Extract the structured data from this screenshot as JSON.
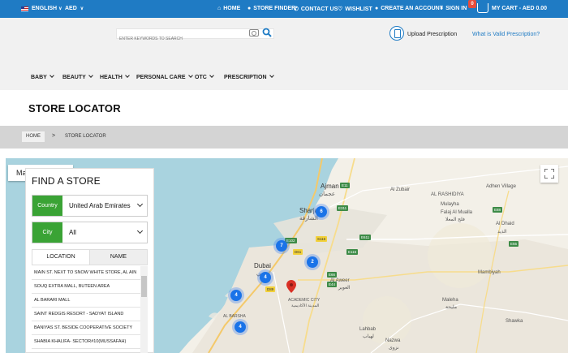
{
  "topbar": {
    "language": "ENGLISH",
    "currency": "AED",
    "links": {
      "home": "HOME",
      "store_finder": "STORE FINDER",
      "contact": "CONTACT US",
      "wishlist": "WISHLIST",
      "create_account": "CREATE AN ACCOUNT",
      "sign_in": "SIGN IN"
    },
    "cart_count": "0",
    "cart_label": "MY CART - AED 0.00",
    "bg_color": "#1f7bc4"
  },
  "header": {
    "search_placeholder": "ENTER KEYWORDS TO SEARCH",
    "upload_prescription": "Upload Prescription",
    "valid_prescription": "What is Valid Prescription?"
  },
  "nav": {
    "items": [
      "BABY",
      "BEAUTY",
      "HEALTH",
      "PERSONAL CARE",
      "OTC",
      "PRESCRIPTION"
    ]
  },
  "page": {
    "title": "STORE LOCATOR",
    "breadcrumb_home": "HOME",
    "breadcrumb_sep": ">",
    "breadcrumb_current": "STORE LOCATOR"
  },
  "map": {
    "type_label": "Map",
    "clusters": [
      "6",
      "7",
      "4",
      "2",
      "4",
      "4"
    ],
    "labels": {
      "ajman": "Ajman",
      "ajman_ar": "عجمان",
      "sharjah": "Sharjah",
      "sharjah_ar": "الشارقة",
      "dubai": "Dubai",
      "dubai_ar": "دبي",
      "al_zubair": "Al Zubair",
      "al_rashidiya": "AL RASHIDIYA",
      "al_aweer": "Al Aweer",
      "al_aweer_ar": "العوير",
      "academic_city": "ACADEMIC CITY",
      "academic_city_ar": "المدينة الأكاديمية",
      "al_barsha": "AL BARSHA",
      "adhen_village": "Adhen Village",
      "mulayha": "Mulayha",
      "falaj": "Falaj Al Mualla",
      "falaj_ar": "فلج المعلا",
      "al_dhaid": "Al Dhaid",
      "al_dhaid_ar": "الذيد",
      "mambiyah": "Mambiyah",
      "maleha": "Maleha",
      "maleha_ar": "مليحة",
      "shawka": "Shawka",
      "lahbab": "Lahbab",
      "lahbab_ar": "لهباب",
      "nazwa": "Nazwa",
      "nazwa_ar": "نزوى"
    },
    "roads": [
      "E11",
      "E311",
      "E611",
      "E88",
      "E55",
      "E44",
      "E66",
      "E102",
      "E116",
      "D61",
      "D89",
      "S116"
    ]
  },
  "finder": {
    "title": "FIND A STORE",
    "country_label": "Country",
    "country_value": "United Arab Emirates",
    "city_label": "City",
    "city_value": "All",
    "tab_location": "LOCATION",
    "tab_name": "NAME",
    "accent": "#3aa335",
    "stores": [
      "MAIN ST. NEXT TO SNOW WHITE STORE, AL AIN",
      "SOUQ EXTRA MALL, BUTEEN AREA",
      "AL BARARI MALL",
      "SAINT REDGIS RESORT - SADYAT ISLAND",
      "BANIYAS ST. BESIDE COOPERATIVE SOCIETY",
      "SHABIA KHALIFA- SECTOR#10(MUSSAFAH)"
    ]
  }
}
